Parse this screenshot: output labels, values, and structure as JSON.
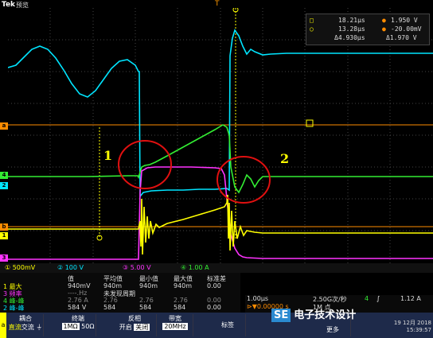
{
  "header": {
    "brand": "Tek",
    "state": "预览",
    "trigger_marker": "T"
  },
  "channel_markers": {
    "c3": "3",
    "c4": "4",
    "c2": "2",
    "c1": "1",
    "ca": "a",
    "cb": "b"
  },
  "cursor_readout": {
    "row1_time": "18.21μs",
    "row1_val": "1.950 V",
    "row2_time": "13.28μs",
    "row2_val": "-20.00mV",
    "delta_time": "Δ4.930μs",
    "delta_val": "Δ1.970 V"
  },
  "annotations": {
    "m1": "1",
    "m2": "2"
  },
  "channel_scales": {
    "ch1": "500mV",
    "ch2": "100 V",
    "ch3": "5.00 V",
    "ch4": "1.00 A"
  },
  "measurements": {
    "headers": [
      "值",
      "平均值",
      "最小值",
      "最大值",
      "标准差"
    ],
    "rows": [
      {
        "idx": "1",
        "name": "最大",
        "val": "940mV",
        "mean": "940m",
        "min": "940m",
        "max": "940m",
        "std": "0.00"
      },
      {
        "idx": "3",
        "name": "频率",
        "val": "----.Hz",
        "mean": "未发现周期",
        "min": "",
        "max": "",
        "std": ""
      },
      {
        "idx": "4",
        "name": "峰-峰",
        "val": "2.76 A",
        "mean": "2.76",
        "min": "2.76",
        "max": "2.76",
        "std": "0.00"
      },
      {
        "idx": "2",
        "name": "峰-峰",
        "val": "584 V",
        "mean": "584",
        "min": "584",
        "max": "584",
        "std": "0.00"
      }
    ]
  },
  "timebase": {
    "scale": "1.00μs",
    "position": "⊳▼0.00000 s",
    "sample_rate": "2.50G次/秒",
    "record": "1M 点",
    "trig_ch": "4",
    "trig_level": "1.12 A",
    "date": "19 12月 2018",
    "time": "15:39:57"
  },
  "menu": {
    "coupling_label": "耦合",
    "coupling_opt1": "直流",
    "coupling_opt2": "交流",
    "term_label": "终端",
    "term_opt1": "1MΩ",
    "term_opt2": "50Ω",
    "invert_label": "反相",
    "invert_opt1": "开启",
    "invert_opt2": "关闭",
    "bw_label": "带宽",
    "bw_value": "20MHz",
    "tag_label": "标签",
    "more_label": "更多",
    "label_chip": "a"
  },
  "watermark": {
    "se": "SE",
    "text": "电子技术设计"
  },
  "colors": {
    "ch1": "#ffff00",
    "ch2": "#00e5ff",
    "ch3": "#ff33ff",
    "ch4": "#33ee33",
    "ref": "#ff8c00",
    "annotation": "#e01010"
  }
}
